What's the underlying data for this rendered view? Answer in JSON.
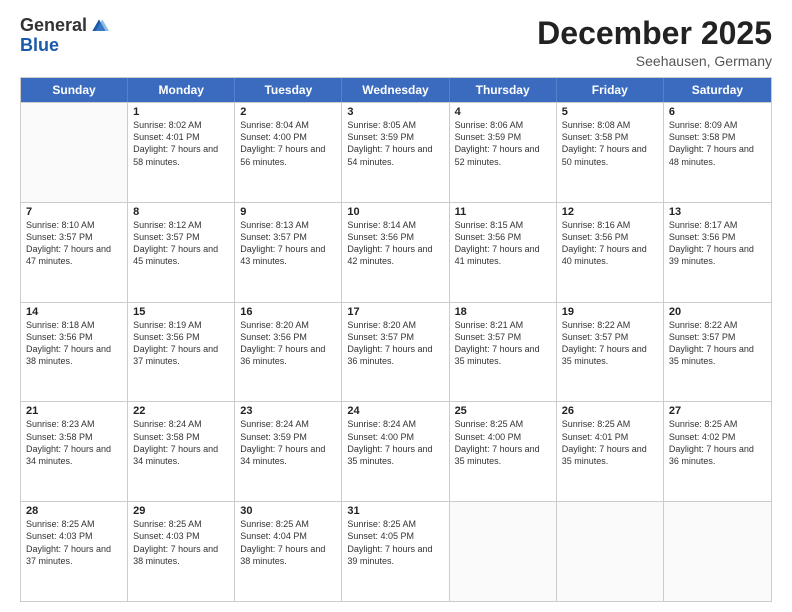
{
  "header": {
    "logo": {
      "general": "General",
      "blue": "Blue"
    },
    "title": "December 2025",
    "location": "Seehausen, Germany"
  },
  "weekdays": [
    "Sunday",
    "Monday",
    "Tuesday",
    "Wednesday",
    "Thursday",
    "Friday",
    "Saturday"
  ],
  "rows": [
    [
      {
        "day": "",
        "sunrise": "",
        "sunset": "",
        "daylight": "",
        "empty": true
      },
      {
        "day": "1",
        "sunrise": "Sunrise: 8:02 AM",
        "sunset": "Sunset: 4:01 PM",
        "daylight": "Daylight: 7 hours and 58 minutes."
      },
      {
        "day": "2",
        "sunrise": "Sunrise: 8:04 AM",
        "sunset": "Sunset: 4:00 PM",
        "daylight": "Daylight: 7 hours and 56 minutes."
      },
      {
        "day": "3",
        "sunrise": "Sunrise: 8:05 AM",
        "sunset": "Sunset: 3:59 PM",
        "daylight": "Daylight: 7 hours and 54 minutes."
      },
      {
        "day": "4",
        "sunrise": "Sunrise: 8:06 AM",
        "sunset": "Sunset: 3:59 PM",
        "daylight": "Daylight: 7 hours and 52 minutes."
      },
      {
        "day": "5",
        "sunrise": "Sunrise: 8:08 AM",
        "sunset": "Sunset: 3:58 PM",
        "daylight": "Daylight: 7 hours and 50 minutes."
      },
      {
        "day": "6",
        "sunrise": "Sunrise: 8:09 AM",
        "sunset": "Sunset: 3:58 PM",
        "daylight": "Daylight: 7 hours and 48 minutes."
      }
    ],
    [
      {
        "day": "7",
        "sunrise": "Sunrise: 8:10 AM",
        "sunset": "Sunset: 3:57 PM",
        "daylight": "Daylight: 7 hours and 47 minutes."
      },
      {
        "day": "8",
        "sunrise": "Sunrise: 8:12 AM",
        "sunset": "Sunset: 3:57 PM",
        "daylight": "Daylight: 7 hours and 45 minutes."
      },
      {
        "day": "9",
        "sunrise": "Sunrise: 8:13 AM",
        "sunset": "Sunset: 3:57 PM",
        "daylight": "Daylight: 7 hours and 43 minutes."
      },
      {
        "day": "10",
        "sunrise": "Sunrise: 8:14 AM",
        "sunset": "Sunset: 3:56 PM",
        "daylight": "Daylight: 7 hours and 42 minutes."
      },
      {
        "day": "11",
        "sunrise": "Sunrise: 8:15 AM",
        "sunset": "Sunset: 3:56 PM",
        "daylight": "Daylight: 7 hours and 41 minutes."
      },
      {
        "day": "12",
        "sunrise": "Sunrise: 8:16 AM",
        "sunset": "Sunset: 3:56 PM",
        "daylight": "Daylight: 7 hours and 40 minutes."
      },
      {
        "day": "13",
        "sunrise": "Sunrise: 8:17 AM",
        "sunset": "Sunset: 3:56 PM",
        "daylight": "Daylight: 7 hours and 39 minutes."
      }
    ],
    [
      {
        "day": "14",
        "sunrise": "Sunrise: 8:18 AM",
        "sunset": "Sunset: 3:56 PM",
        "daylight": "Daylight: 7 hours and 38 minutes."
      },
      {
        "day": "15",
        "sunrise": "Sunrise: 8:19 AM",
        "sunset": "Sunset: 3:56 PM",
        "daylight": "Daylight: 7 hours and 37 minutes."
      },
      {
        "day": "16",
        "sunrise": "Sunrise: 8:20 AM",
        "sunset": "Sunset: 3:56 PM",
        "daylight": "Daylight: 7 hours and 36 minutes."
      },
      {
        "day": "17",
        "sunrise": "Sunrise: 8:20 AM",
        "sunset": "Sunset: 3:57 PM",
        "daylight": "Daylight: 7 hours and 36 minutes."
      },
      {
        "day": "18",
        "sunrise": "Sunrise: 8:21 AM",
        "sunset": "Sunset: 3:57 PM",
        "daylight": "Daylight: 7 hours and 35 minutes."
      },
      {
        "day": "19",
        "sunrise": "Sunrise: 8:22 AM",
        "sunset": "Sunset: 3:57 PM",
        "daylight": "Daylight: 7 hours and 35 minutes."
      },
      {
        "day": "20",
        "sunrise": "Sunrise: 8:22 AM",
        "sunset": "Sunset: 3:57 PM",
        "daylight": "Daylight: 7 hours and 35 minutes."
      }
    ],
    [
      {
        "day": "21",
        "sunrise": "Sunrise: 8:23 AM",
        "sunset": "Sunset: 3:58 PM",
        "daylight": "Daylight: 7 hours and 34 minutes."
      },
      {
        "day": "22",
        "sunrise": "Sunrise: 8:24 AM",
        "sunset": "Sunset: 3:58 PM",
        "daylight": "Daylight: 7 hours and 34 minutes."
      },
      {
        "day": "23",
        "sunrise": "Sunrise: 8:24 AM",
        "sunset": "Sunset: 3:59 PM",
        "daylight": "Daylight: 7 hours and 34 minutes."
      },
      {
        "day": "24",
        "sunrise": "Sunrise: 8:24 AM",
        "sunset": "Sunset: 4:00 PM",
        "daylight": "Daylight: 7 hours and 35 minutes."
      },
      {
        "day": "25",
        "sunrise": "Sunrise: 8:25 AM",
        "sunset": "Sunset: 4:00 PM",
        "daylight": "Daylight: 7 hours and 35 minutes."
      },
      {
        "day": "26",
        "sunrise": "Sunrise: 8:25 AM",
        "sunset": "Sunset: 4:01 PM",
        "daylight": "Daylight: 7 hours and 35 minutes."
      },
      {
        "day": "27",
        "sunrise": "Sunrise: 8:25 AM",
        "sunset": "Sunset: 4:02 PM",
        "daylight": "Daylight: 7 hours and 36 minutes."
      }
    ],
    [
      {
        "day": "28",
        "sunrise": "Sunrise: 8:25 AM",
        "sunset": "Sunset: 4:03 PM",
        "daylight": "Daylight: 7 hours and 37 minutes."
      },
      {
        "day": "29",
        "sunrise": "Sunrise: 8:25 AM",
        "sunset": "Sunset: 4:03 PM",
        "daylight": "Daylight: 7 hours and 38 minutes."
      },
      {
        "day": "30",
        "sunrise": "Sunrise: 8:25 AM",
        "sunset": "Sunset: 4:04 PM",
        "daylight": "Daylight: 7 hours and 38 minutes."
      },
      {
        "day": "31",
        "sunrise": "Sunrise: 8:25 AM",
        "sunset": "Sunset: 4:05 PM",
        "daylight": "Daylight: 7 hours and 39 minutes."
      },
      {
        "day": "",
        "sunrise": "",
        "sunset": "",
        "daylight": "",
        "empty": true
      },
      {
        "day": "",
        "sunrise": "",
        "sunset": "",
        "daylight": "",
        "empty": true
      },
      {
        "day": "",
        "sunrise": "",
        "sunset": "",
        "daylight": "",
        "empty": true
      }
    ]
  ]
}
